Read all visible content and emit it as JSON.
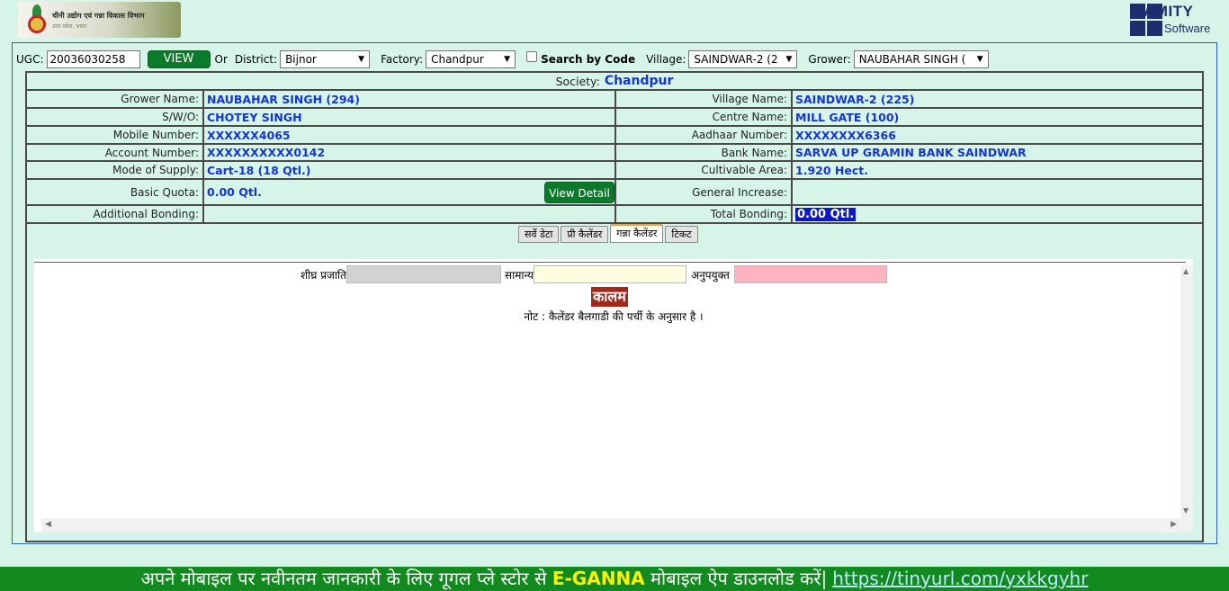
{
  "header": {
    "logo_title": "चीनी उद्योग एवं गन्ना विकास विभाग",
    "logo_subtitle": "उत्तर प्रदेश, भारत",
    "brand_word": "AMITY",
    "brand_sub": "Software"
  },
  "filters": {
    "ugc_label": "UGC:",
    "ugc_value": "20036030258",
    "view_label": "VIEW",
    "or_label": "Or",
    "district_label": "District:",
    "district_value": "Bijnor",
    "factory_label": "Factory:",
    "factory_value": "Chandpur",
    "search_code_label": "Search by Code",
    "village_label": "Village:",
    "village_value": "SAINDWAR-2 (2",
    "grower_label": "Grower:",
    "grower_value": "NAUBAHAR SINGH ("
  },
  "society": {
    "label": "Society:",
    "value": "Chandpur"
  },
  "details": {
    "grower_name_label": "Grower Name:",
    "grower_name": "NAUBAHAR SINGH (294)",
    "village_name_label": "Village Name:",
    "village_name": "SAINDWAR-2 (225)",
    "swo_label": "S/W/O:",
    "swo": "CHOTEY SINGH",
    "centre_label": "Centre Name:",
    "centre": "MILL GATE (100)",
    "mobile_label": "Mobile Number:",
    "mobile": "XXXXXX4065",
    "aadhaar_label": "Aadhaar Number:",
    "aadhaar": "XXXXXXXX6366",
    "account_label": "Account Number:",
    "account": "XXXXXXXXXX0142",
    "bank_label": "Bank Name:",
    "bank": "SARVA UP GRAMIN BANK SAINDWAR",
    "supply_label": "Mode of Supply:",
    "supply": "Cart-18 (18 Qtl.)",
    "area_label": "Cultivable Area:",
    "area": "1.920 Hect.",
    "quota_label": "Basic Quota:",
    "quota": "0.00 Qtl.",
    "view_detail_label": "View Detail",
    "increase_label": "General Increase:",
    "increase": "",
    "additional_label": "Additional Bonding:",
    "additional": "",
    "total_label": "Total Bonding:",
    "total": "0.00 Qtl."
  },
  "tabs": [
    {
      "label": "सर्वे डेटा"
    },
    {
      "label": "प्री कैलेंडर"
    },
    {
      "label": "गन्ना कैलेंडर"
    },
    {
      "label": "टिकट"
    }
  ],
  "calendar": {
    "legend_early": "शीघ्र प्रजाति",
    "legend_general": "सामान्य",
    "legend_unfit": "अनुपयुक्त",
    "column_head": "कालम",
    "note": "नोट : कैलेंडर बैलगाडी की पर्ची के अनुसार है ।"
  },
  "banner": {
    "text": "अपने मोबाइल पर नवीनतम जानकारी के लिए गूगल प्ले स्टोर से ",
    "app": "E-GANNA",
    "text2": " मोबाइल ऐप डाउनलोड करें|",
    "link": "https://tinyurl.com/yxkkgyhr"
  },
  "colors": {
    "accent_green": "#0b7a2a",
    "value_blue": "#1435d0",
    "background": "#d6f5e8",
    "banner_green": "#128a1f"
  }
}
